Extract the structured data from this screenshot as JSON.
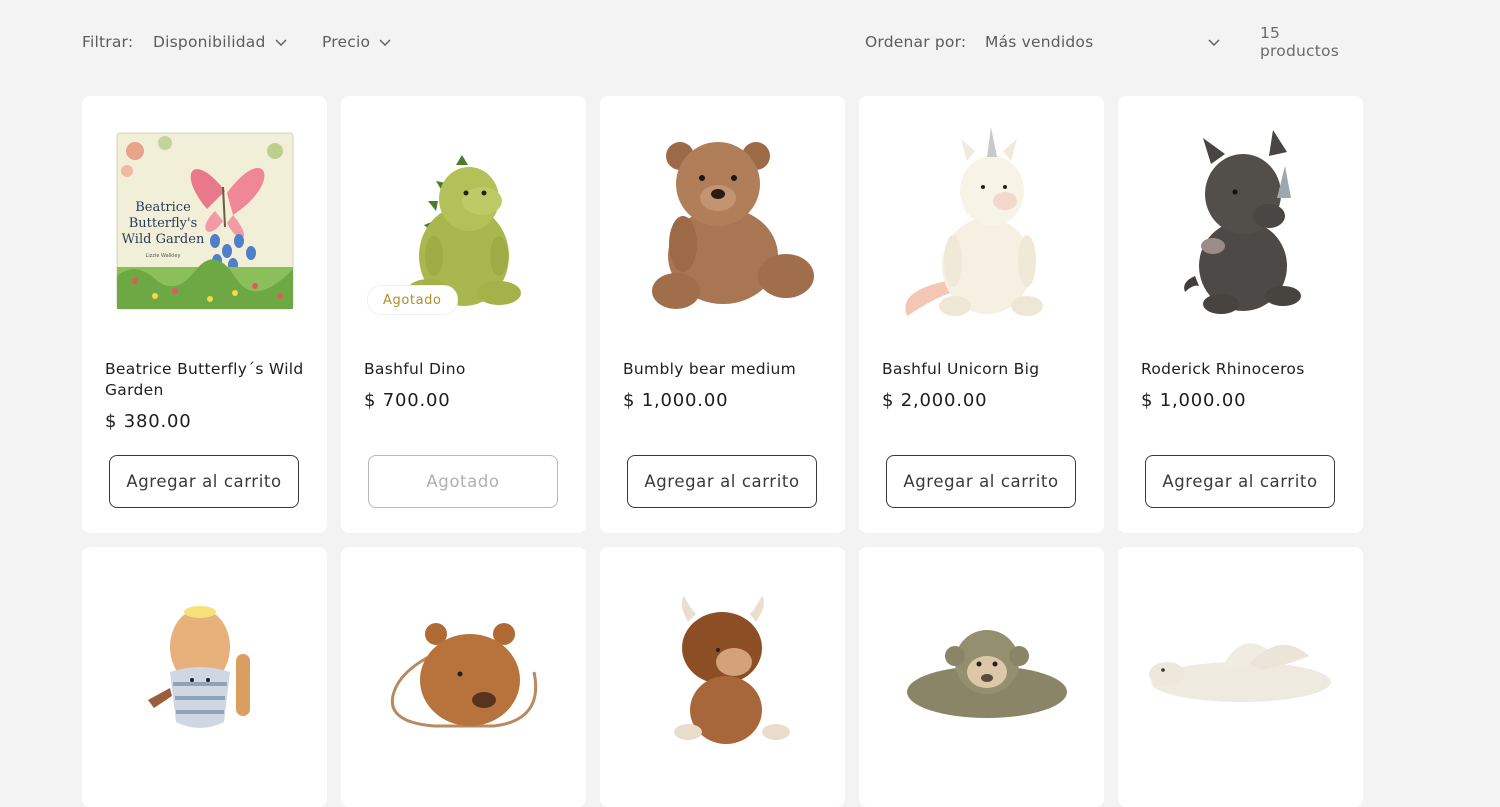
{
  "filters": {
    "filter_label": "Filtrar:",
    "availability_label": "Disponibilidad",
    "price_label": "Precio",
    "sort_label": "Ordenar por:",
    "sort_value": "Más vendidos",
    "product_count": "15 productos"
  },
  "products": [
    {
      "title": "Beatrice Butterfly´s Wild Garden",
      "price": "$ 380.00",
      "button": "Agregar al carrito",
      "image_icon": "book-icon"
    },
    {
      "title": "Bashful Dino",
      "price": "$ 700.00",
      "button": "Agotado",
      "badge": "Agotado",
      "image_icon": "dino-plush-icon"
    },
    {
      "title": "Bumbly bear medium",
      "price": "$ 1,000.00",
      "button": "Agregar al carrito",
      "image_icon": "bear-plush-icon"
    },
    {
      "title": "Bashful Unicorn Big",
      "price": "$ 2,000.00",
      "button": "Agregar al carrito",
      "image_icon": "unicorn-plush-icon"
    },
    {
      "title": "Roderick Rhinoceros",
      "price": "$ 1,000.00",
      "button": "Agregar al carrito",
      "image_icon": "rhino-plush-icon"
    }
  ],
  "products_row2": [
    {
      "image_icon": "egg-cup-plush-icon"
    },
    {
      "image_icon": "bear-bag-icon"
    },
    {
      "image_icon": "highland-cow-plush-icon"
    },
    {
      "image_icon": "monkey-plush-icon"
    },
    {
      "image_icon": "dragon-plush-icon"
    }
  ],
  "book_cover": {
    "line1": "Beatrice",
    "line2": "Butterfly's",
    "line3": "Wild Garden",
    "author": "Lizzie Walkley"
  },
  "colors": {
    "background": "#f3f3f3",
    "card": "#ffffff",
    "badge_text": "#b08e2e",
    "button_border": "#3a3a3a"
  }
}
